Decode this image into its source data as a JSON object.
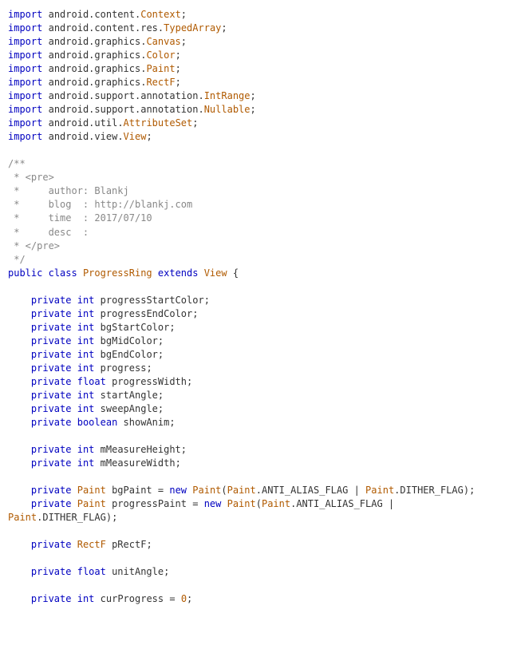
{
  "code": {
    "imports": [
      {
        "segments": [
          "android",
          "content",
          "Context"
        ]
      },
      {
        "segments": [
          "android",
          "content",
          "res",
          "TypedArray"
        ]
      },
      {
        "segments": [
          "android",
          "graphics",
          "Canvas"
        ]
      },
      {
        "segments": [
          "android",
          "graphics",
          "Color"
        ]
      },
      {
        "segments": [
          "android",
          "graphics",
          "Paint"
        ]
      },
      {
        "segments": [
          "android",
          "graphics",
          "RectF"
        ]
      },
      {
        "segments": [
          "android",
          "support",
          "annotation",
          "IntRange"
        ]
      },
      {
        "segments": [
          "android",
          "support",
          "annotation",
          "Nullable"
        ]
      },
      {
        "segments": [
          "android",
          "util",
          "AttributeSet"
        ]
      },
      {
        "segments": [
          "android",
          "view",
          "View"
        ]
      }
    ],
    "javadoc": [
      "/**",
      " * <pre>",
      " *     author: Blankj",
      " *     blog  : http://blankj.com",
      " *     time  : 2017/07/10",
      " *     desc  :",
      " * </pre>",
      " */"
    ],
    "class_decl": {
      "modifiers": [
        "public",
        "class"
      ],
      "name": "ProgressRing",
      "extends_kw": "extends",
      "super": "View"
    },
    "fields": [
      {
        "mods": [
          "private"
        ],
        "type": "int",
        "name": "progressStartColor"
      },
      {
        "mods": [
          "private"
        ],
        "type": "int",
        "name": "progressEndColor"
      },
      {
        "mods": [
          "private"
        ],
        "type": "int",
        "name": "bgStartColor"
      },
      {
        "mods": [
          "private"
        ],
        "type": "int",
        "name": "bgMidColor"
      },
      {
        "mods": [
          "private"
        ],
        "type": "int",
        "name": "bgEndColor"
      },
      {
        "mods": [
          "private"
        ],
        "type": "int",
        "name": "progress"
      },
      {
        "mods": [
          "private"
        ],
        "type": "float",
        "name": "progressWidth"
      },
      {
        "mods": [
          "private"
        ],
        "type": "int",
        "name": "startAngle"
      },
      {
        "mods": [
          "private"
        ],
        "type": "int",
        "name": "sweepAngle"
      },
      {
        "mods": [
          "private"
        ],
        "type": "boolean",
        "name": "showAnim"
      }
    ],
    "fields2": [
      {
        "mods": [
          "private"
        ],
        "type": "int",
        "name": "mMeasureHeight"
      },
      {
        "mods": [
          "private"
        ],
        "type": "int",
        "name": "mMeasureWidth"
      }
    ],
    "paint_fields": [
      {
        "mods": [
          "private"
        ],
        "type": "Paint",
        "name": "bgPaint",
        "init": {
          "new_kw": "new",
          "ctor": "Paint",
          "args": [
            "Paint.ANTI_ALIAS_FLAG",
            "Paint.DITHER_FLAG"
          ],
          "wrap": false
        }
      },
      {
        "mods": [
          "private"
        ],
        "type": "Paint",
        "name": "progressPaint",
        "init": {
          "new_kw": "new",
          "ctor": "Paint",
          "args": [
            "Paint.ANTI_ALIAS_FLAG",
            "Paint.DITHER_FLAG"
          ],
          "wrap": true
        }
      }
    ],
    "rectf_field": {
      "mods": [
        "private"
      ],
      "type": "RectF",
      "name": "pRectF"
    },
    "unit_field": {
      "mods": [
        "private"
      ],
      "type": "float",
      "name": "unitAngle"
    },
    "cur_field": {
      "mods": [
        "private"
      ],
      "type": "int",
      "name": "curProgress",
      "init_literal": "0"
    }
  }
}
